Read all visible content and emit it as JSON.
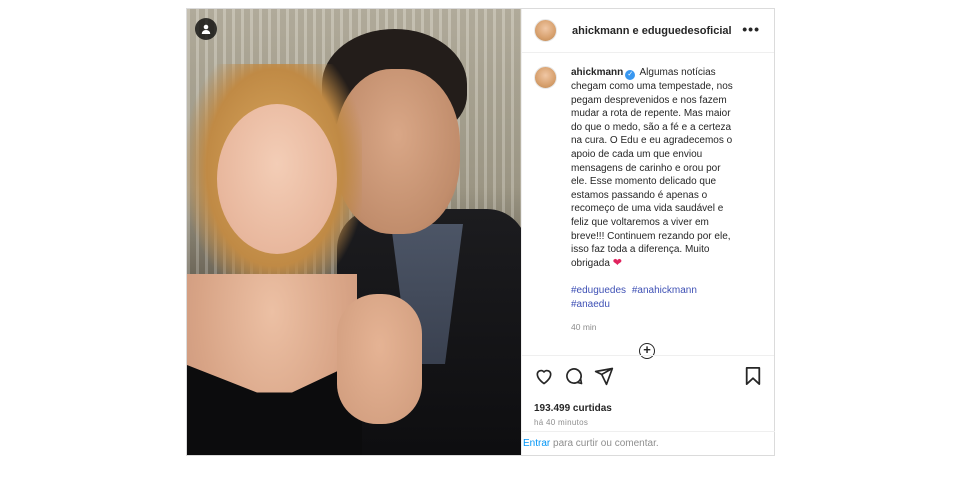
{
  "post": {
    "header_user": "ahickmann e eduguedesoficial",
    "more_glyph": "•••",
    "caption_user": "ahickmann",
    "caption_lines": [
      "Algumas notícias",
      "chegam como uma tempestade, nos",
      "pegam desprevenidos e nos fazem",
      "mudar a rota de repente. Mas maior",
      "do que o medo, são a fé e a certeza",
      "na cura. O Edu e eu agradecemos o",
      "apoio de cada um que enviou",
      "mensagens de carinho e orou por",
      "ele. Esse momento delicado que",
      "estamos passando é apenas o",
      "recomeço de uma vida saudável e",
      "feliz que voltaremos a viver em",
      "breve!!! Continuem rezando por ele,",
      "isso faz toda a diferença. Muito",
      "obrigada"
    ],
    "heart_emoji": "❤",
    "hashtags": [
      "#eduguedes",
      "#anahickmann",
      "#anaedu"
    ],
    "caption_time": "40 min",
    "likes": "193.499 curtidas",
    "time_ago": "há 40 minutos",
    "login_link": "Entrar",
    "comment_prompt": "para curtir ou comentar.",
    "colors": {
      "link": "#0095f6",
      "hashtag": "#3f51b5",
      "verified": "#3897f0",
      "border": "#dbdbdb"
    },
    "icons": [
      "user-tag-icon",
      "verified-icon",
      "load-more-icon",
      "heart-icon",
      "comment-icon",
      "share-icon",
      "bookmark-icon"
    ]
  }
}
